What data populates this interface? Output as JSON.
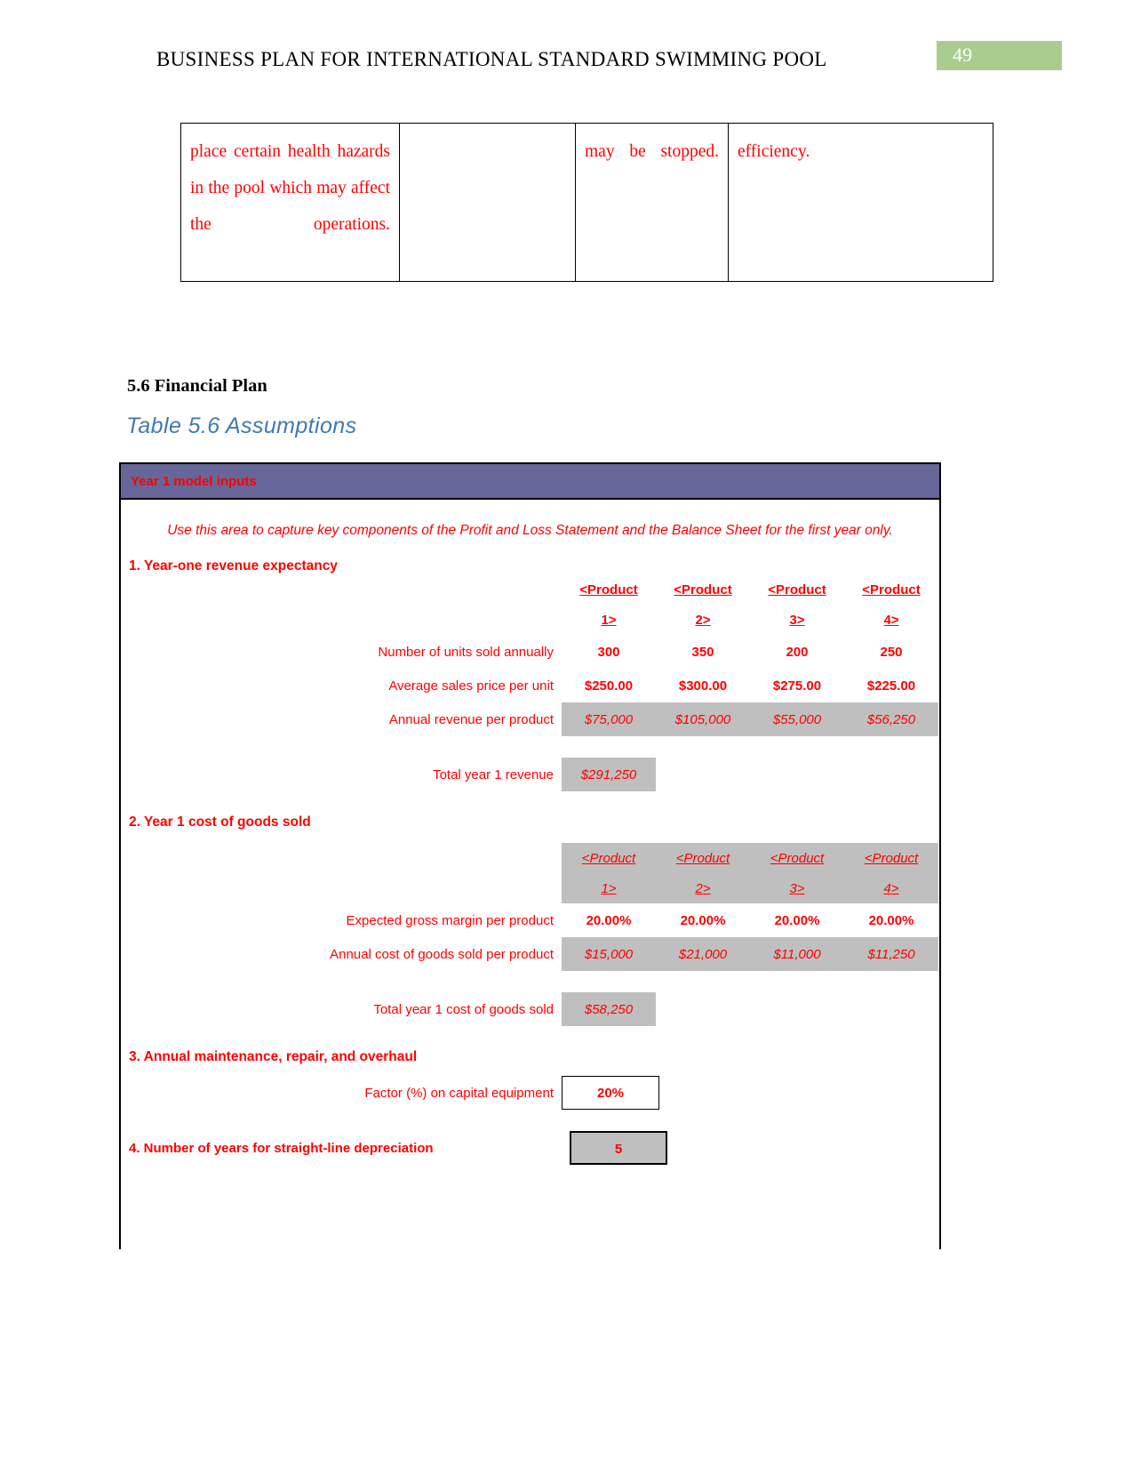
{
  "header": {
    "title": "BUSINESS PLAN FOR INTERNATIONAL STANDARD SWIMMING POOL",
    "page_number": "49",
    "badge_color": "#a9cd8e"
  },
  "top_table": {
    "cells": [
      "place certain health hazards in the pool which may affect the operations.",
      "",
      "may be stopped.",
      "efficiency."
    ]
  },
  "section": {
    "heading": "5.6 Financial Plan",
    "caption": "Table 5.6 Assumptions",
    "caption_color": "#3d7ab5"
  },
  "sheet": {
    "title": "Year 1 model inputs",
    "title_bar_color": "#666699",
    "text_color": "#ff0000",
    "shade_color": "#bfbfbf",
    "intro": "Use this area to capture key components of the Profit and Loss Statement and the Balance Sheet for the first year only.",
    "section1": {
      "title": "1. Year-one revenue expectancy",
      "product_headers_line1": [
        "<Product",
        "<Product",
        "<Product",
        "<Product"
      ],
      "product_headers_line2": [
        "1>",
        "2>",
        "3>",
        "4>"
      ],
      "rows": [
        {
          "label": "Number of units sold annually",
          "values": [
            "300",
            "350",
            "200",
            "250"
          ]
        },
        {
          "label": "Average sales price per unit",
          "values": [
            "$250.00",
            "$300.00",
            "$275.00",
            "$225.00"
          ]
        },
        {
          "label": "Annual revenue per product",
          "values": [
            "$75,000",
            "$105,000",
            "$55,000",
            "$56,250"
          ]
        }
      ],
      "total_label": "Total year 1 revenue",
      "total_value": "$291,250"
    },
    "section2": {
      "title": "2. Year 1 cost of goods sold",
      "product_headers_line1": [
        "<Product",
        "<Product",
        "<Product",
        "<Product"
      ],
      "product_headers_line2": [
        "1>",
        "2>",
        "3>",
        "4>"
      ],
      "rows": [
        {
          "label": "Expected gross margin per product",
          "values": [
            "20.00%",
            "20.00%",
            "20.00%",
            "20.00%"
          ]
        },
        {
          "label": "Annual cost of goods sold per product",
          "values": [
            "$15,000",
            "$21,000",
            "$11,000",
            "$11,250"
          ]
        }
      ],
      "total_label": "Total year 1 cost of goods sold",
      "total_value": "$58,250"
    },
    "section3": {
      "title": "3. Annual maintenance, repair, and overhaul",
      "label": "Factor (%) on capital equipment",
      "value": "20%"
    },
    "section4": {
      "title": "4. Number of years for straight-line depreciation",
      "value": "5"
    }
  }
}
